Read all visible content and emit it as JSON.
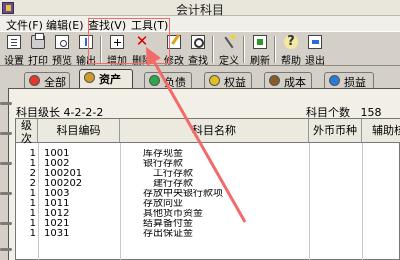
{
  "window": {
    "title": "会计科目"
  },
  "menu": [
    "文件(F)",
    "编辑(E)",
    "查找(V)",
    "工具(T)"
  ],
  "toolbar": [
    {
      "label": "设置",
      "icon": "settings-doc-icon"
    },
    {
      "label": "打印",
      "icon": "printer-icon"
    },
    {
      "label": "预览",
      "icon": "preview-icon"
    },
    {
      "label": "输出",
      "icon": "export-icon"
    },
    {
      "label": "增加",
      "icon": "add-icon"
    },
    {
      "label": "删除",
      "icon": "delete-x-icon"
    },
    {
      "label": "修改",
      "icon": "edit-icon"
    },
    {
      "label": "查找",
      "icon": "find-icon"
    },
    {
      "label": "定义",
      "icon": "magic-wand-icon"
    },
    {
      "label": "刷新",
      "icon": "refresh-icon"
    },
    {
      "label": "帮助",
      "icon": "help-icon"
    },
    {
      "label": "退出",
      "icon": "exit-icon"
    }
  ],
  "tabs": [
    {
      "label": "全部",
      "icon": "all-icon",
      "color": "#e2372b"
    },
    {
      "label": "资产",
      "icon": "asset-icon",
      "color": "#d29a2a",
      "active": true
    },
    {
      "label": "负债",
      "icon": "liability-icon",
      "color": "#2aa84a"
    },
    {
      "label": "权益",
      "icon": "equity-icon",
      "color": "#e0c020"
    },
    {
      "label": "成本",
      "icon": "cost-icon",
      "color": "#8a5a2a"
    },
    {
      "label": "损益",
      "icon": "profit-loss-icon",
      "color": "#2a7ad8"
    }
  ],
  "info": {
    "level": "科目级长  4-2-2-2",
    "count_label": "科目个数",
    "count": "158"
  },
  "columns": [
    "级次",
    "科目编码",
    "科目名称",
    "外币币种",
    "辅助核算"
  ],
  "rows": [
    {
      "level": "1",
      "code": "1001",
      "name": "库存现金"
    },
    {
      "level": "1",
      "code": "1002",
      "name": "银行存款"
    },
    {
      "level": "2",
      "code": "100201",
      "name": "　工行存款"
    },
    {
      "level": "2",
      "code": "100202",
      "name": "　建行存款"
    },
    {
      "level": "1",
      "code": "1003",
      "name": "存放中央银行款项"
    },
    {
      "level": "1",
      "code": "1011",
      "name": "存放同业"
    },
    {
      "level": "1",
      "code": "1012",
      "name": "其他货币资金"
    },
    {
      "level": "1",
      "code": "1021",
      "name": "结算备付金"
    },
    {
      "level": "1",
      "code": "1031",
      "name": "存出保证金"
    }
  ],
  "colors": {
    "annotation": "#f26a6a",
    "delete": "#d40000"
  }
}
